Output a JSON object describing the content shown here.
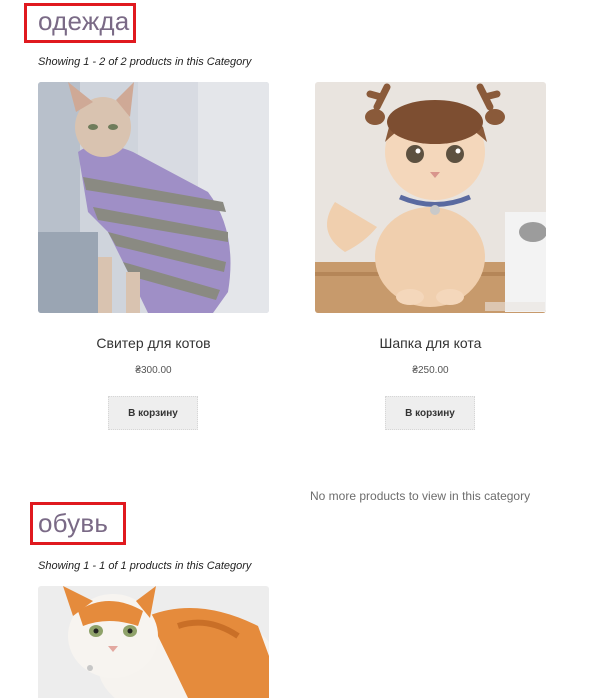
{
  "categories": [
    {
      "title": "одежда",
      "showing": "Showing 1 - 2 of 2 products in this Category",
      "products": [
        {
          "title": "Свитер для котов",
          "price": "₴300.00",
          "button": "В корзину",
          "image": "cat-in-striped-sweater"
        },
        {
          "title": "Шапка для кота",
          "price": "₴250.00",
          "button": "В корзину",
          "image": "cat-in-reindeer-hat"
        }
      ],
      "no_more": "No more products to view in this category"
    },
    {
      "title": "обувь",
      "showing": "Showing 1 - 1 of 1 products in this Category",
      "products": [
        {
          "image": "orange-white-cat"
        }
      ]
    }
  ],
  "colors": {
    "highlight_border": "#e0191f",
    "heading": "#7a6a86",
    "button_bg": "#eeeeee"
  }
}
